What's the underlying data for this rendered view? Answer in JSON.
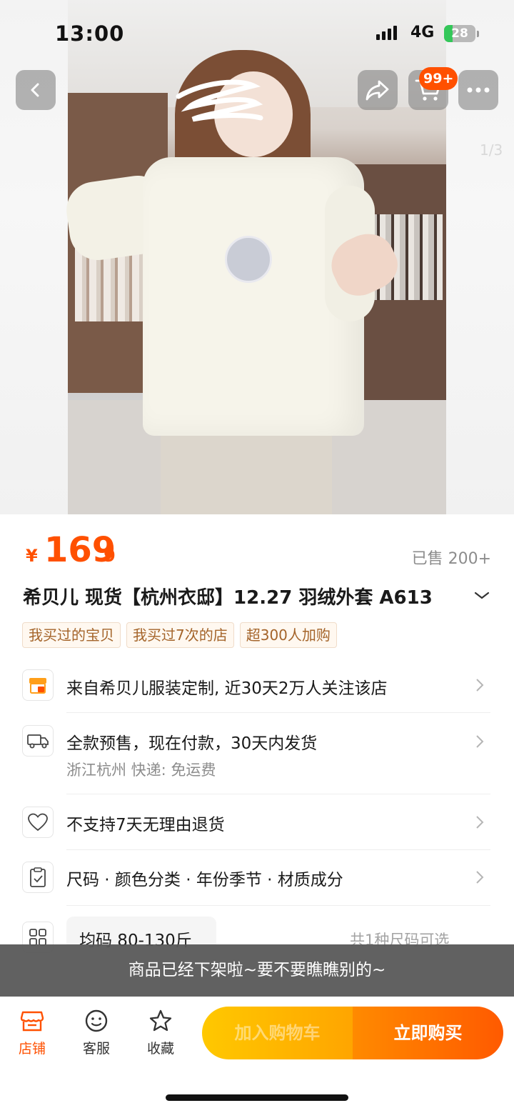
{
  "status_bar": {
    "time": "13:00",
    "network": "4G",
    "battery_level": "28",
    "battery_fraction": 0.28
  },
  "top_actions": {
    "cart_badge": "99+",
    "image_counter": "1/3"
  },
  "product": {
    "currency_symbol": "¥",
    "price_integer": "169",
    "price_decimal": ".9",
    "sold": "已售 200+",
    "title": "希贝儿 现货【杭州衣邸】12.27 羽绒外套 A613",
    "tags": [
      "我买过的宝贝",
      "我买过7次的店",
      "超300人加购"
    ]
  },
  "info_rows": {
    "store": "来自希贝儿服装定制, 近30天2万人关注该店",
    "shipping_main": "全款预售，现在付款，30天内发货",
    "shipping_sub": "浙江杭州  快递: 免运费",
    "returns": "不支持7天无理由退货",
    "specs": "尺码 · 颜色分类 · 年份季节 · 材质成分",
    "size_option": "均码 80-130斤",
    "size_count": "共1种尺码可选"
  },
  "toast": "商品已经下架啦~要不要瞧瞧别的~",
  "bottom_bar": {
    "tabs": [
      {
        "label": "店铺",
        "icon": "store-icon"
      },
      {
        "label": "客服",
        "icon": "customer-service-icon"
      },
      {
        "label": "收藏",
        "icon": "star-icon"
      }
    ],
    "add_to_cart": "加入购物车",
    "buy_now": "立即购买"
  },
  "colors": {
    "accent": "#ff5000",
    "cart_button": "#ffc800",
    "toast_bg": "#585858"
  }
}
